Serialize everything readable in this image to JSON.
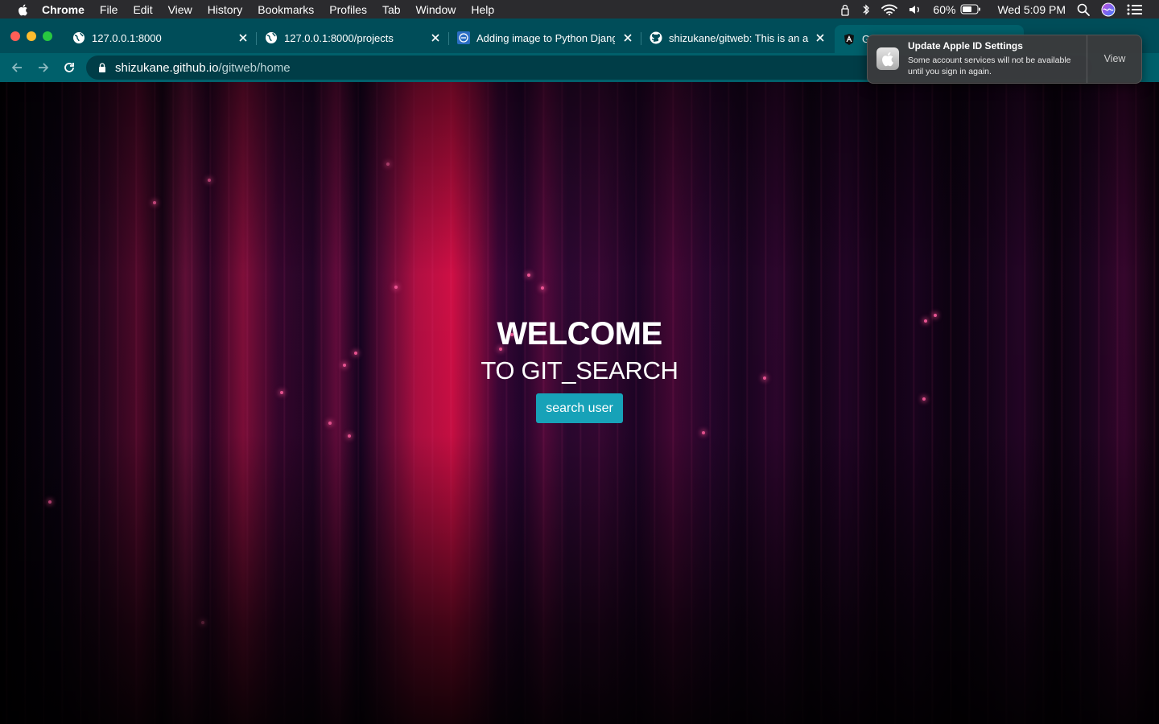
{
  "menubar": {
    "app": "Chrome",
    "items": [
      "File",
      "Edit",
      "View",
      "History",
      "Bookmarks",
      "Profiles",
      "Tab",
      "Window",
      "Help"
    ],
    "battery_percent": "60%",
    "clock": "Wed 5:09 PM",
    "status_icons": [
      "lock-icon",
      "bluetooth-icon",
      "wifi-icon",
      "volume-icon",
      "battery-icon",
      "spotlight-search-icon",
      "siri-icon",
      "control-center-icon"
    ]
  },
  "tabs": [
    {
      "title": "127.0.0.1:8000",
      "icon": "globe-icon"
    },
    {
      "title": "127.0.0.1:8000/projects",
      "icon": "globe-icon"
    },
    {
      "title": "Adding image to Python Django",
      "icon": "site-favicon"
    },
    {
      "title": "shizukane/gitweb: This is an ap",
      "icon": "github-icon"
    },
    {
      "title": "G",
      "icon": "angular-icon"
    }
  ],
  "toolbar": {
    "url_host": "shizukane.github.io",
    "url_path": "/gitweb/home"
  },
  "page": {
    "heading": "WELCOME",
    "subheading": "TO GIT_SEARCH",
    "button_label": "search user",
    "button_color": "#17a2b8"
  },
  "notification": {
    "title": "Update Apple ID Settings",
    "body": "Some account services will not be available until you sign in again.",
    "action": "View"
  },
  "colors": {
    "tabstrip": "#004d59",
    "toolbar": "#00606b",
    "omnibox": "#003d47"
  }
}
